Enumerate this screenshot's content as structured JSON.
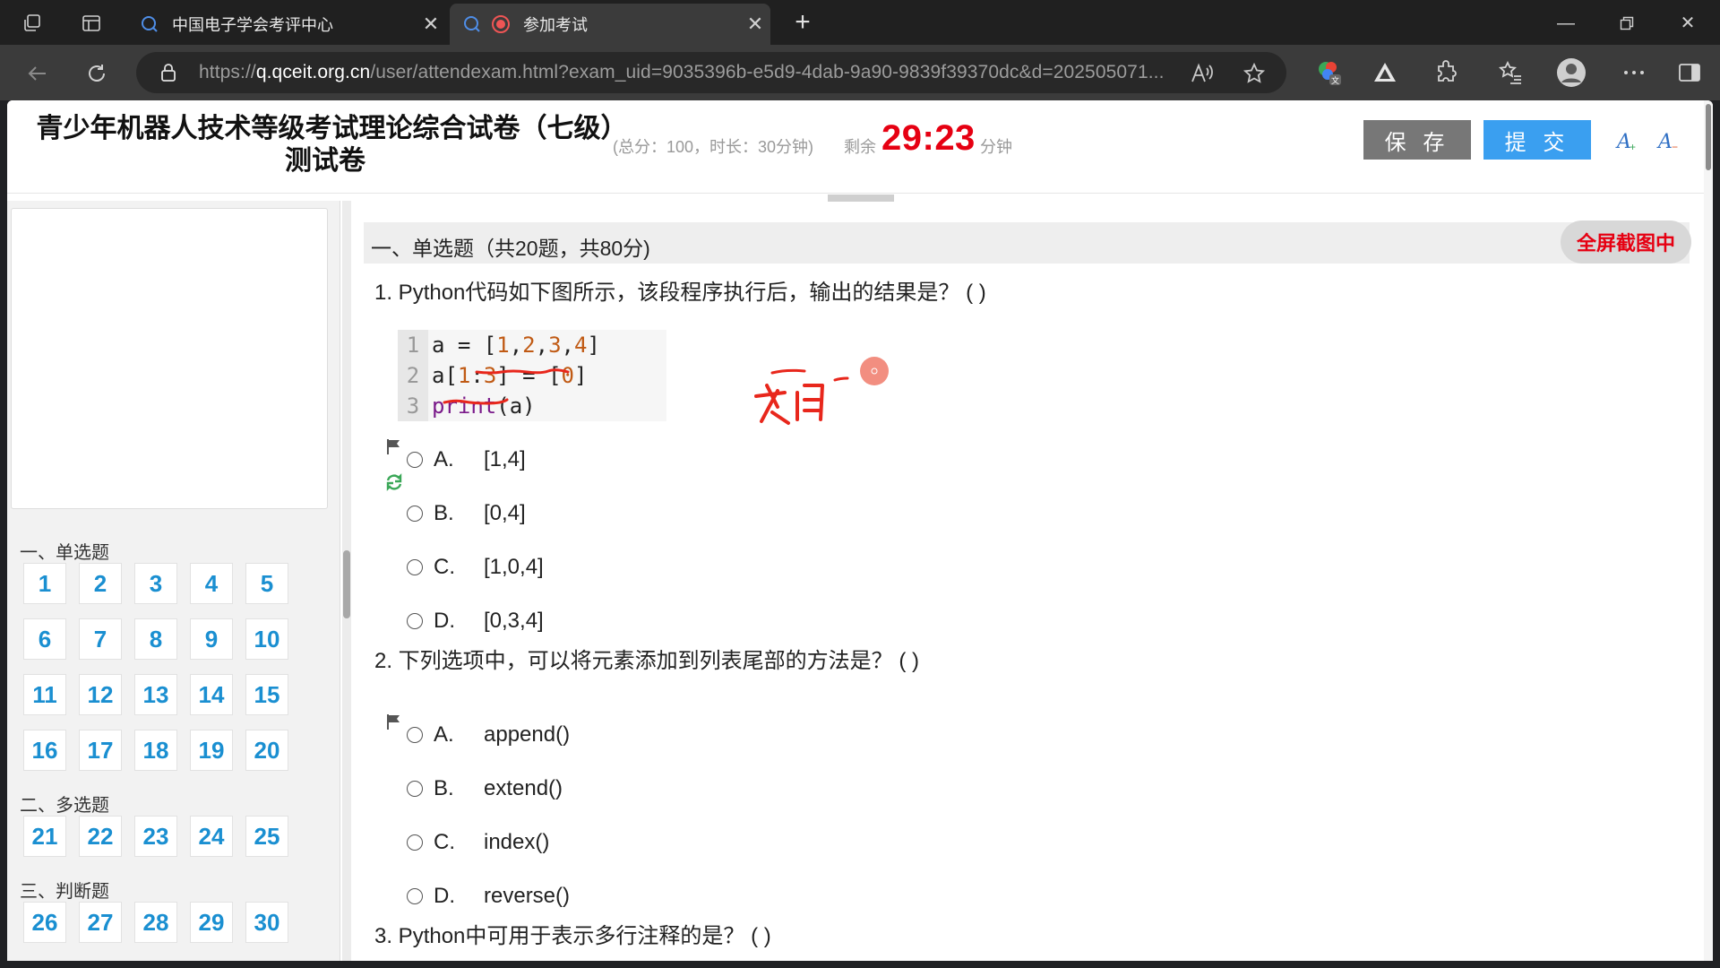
{
  "browser": {
    "tabs": [
      {
        "title": "中国电子学会考评中心"
      },
      {
        "title": "参加考试"
      }
    ],
    "url_prefix": "https://",
    "url_host": "q.qceit.org.cn",
    "url_path": "/user/attendexam.html?exam_uid=9035396b-e5d9-4dab-9a90-9839f39370dc&d=202505071..."
  },
  "exam": {
    "title": "青少年机器人技术等级考试理论综合试卷（七级）测试卷",
    "meta": "(总分：100，时长：30分钟)",
    "remain_label": "剩余",
    "timer": "29:23",
    "minute_label": "分钟",
    "save_label": "保 存",
    "submit_label": "提 交"
  },
  "nav": {
    "sections": [
      {
        "label": "一、单选题",
        "numbers": [
          "1",
          "2",
          "3",
          "4",
          "5",
          "6",
          "7",
          "8",
          "9",
          "10",
          "11",
          "12",
          "13",
          "14",
          "15",
          "16",
          "17",
          "18",
          "19",
          "20"
        ]
      },
      {
        "label": "二、多选题",
        "numbers": [
          "21",
          "22",
          "23",
          "24",
          "25"
        ]
      },
      {
        "label": "三、判断题",
        "numbers": [
          "26",
          "27",
          "28",
          "29",
          "30"
        ]
      }
    ]
  },
  "main": {
    "section_title": "一、单选题（共20题，共80分)",
    "fullscreen_badge": "全屏截图中",
    "questions": [
      {
        "title": "1. Python代码如下图所示，该段程序执行后，输出的结果是？ ( )",
        "code": [
          {
            "ln": "1",
            "text": "a = [1,2,3,4]"
          },
          {
            "ln": "2",
            "text": "a[1:3] = [0]"
          },
          {
            "ln": "3",
            "text": "print(a)"
          }
        ],
        "options": [
          {
            "letter": "A.",
            "text": "[1,4]"
          },
          {
            "letter": "B.",
            "text": "[0,4]"
          },
          {
            "letter": "C.",
            "text": "[1,0,4]"
          },
          {
            "letter": "D.",
            "text": "[0,3,4]"
          }
        ]
      },
      {
        "title": "2. 下列选项中，可以将元素添加到列表尾部的方法是？ ( )",
        "options": [
          {
            "letter": "A.",
            "text": "append()"
          },
          {
            "letter": "B.",
            "text": "extend()"
          },
          {
            "letter": "C.",
            "text": "index()"
          },
          {
            "letter": "D.",
            "text": "reverse()"
          }
        ]
      },
      {
        "title": "3. Python中可用于表示多行注释的是？ ( )"
      }
    ]
  },
  "colors": {
    "timer": "#e60012",
    "link_number": "#1a8fd1",
    "submit": "#3a9ff0",
    "save": "#777777",
    "annotation": "#e8271c"
  }
}
